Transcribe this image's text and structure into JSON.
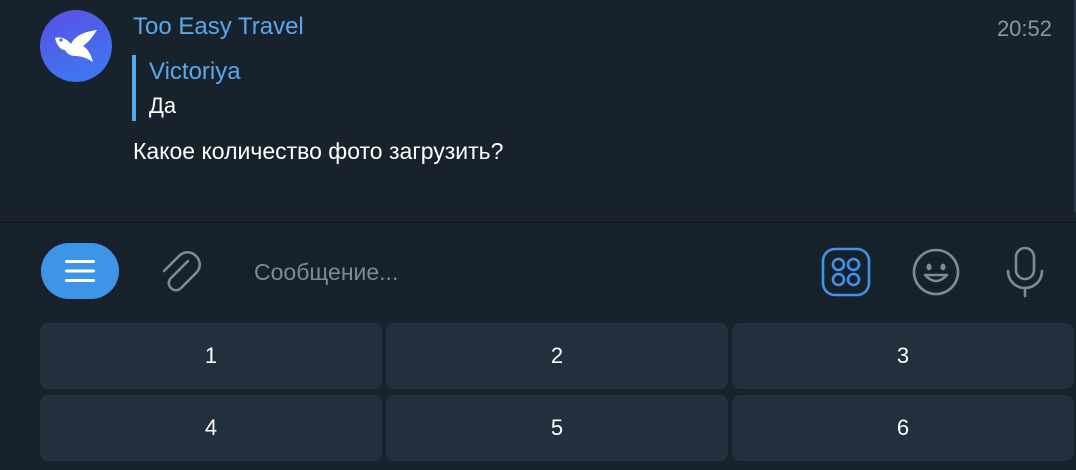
{
  "message": {
    "sender": "Too Easy Travel",
    "time": "20:52",
    "reply": {
      "author": "Victoriya",
      "text": "Да"
    },
    "text": "Какое количество фото загрузить?"
  },
  "composer": {
    "placeholder": "Сообщение..."
  },
  "keyboard": {
    "rows": [
      [
        "1",
        "2",
        "3"
      ],
      [
        "4",
        "5",
        "6"
      ]
    ]
  },
  "colors": {
    "accent": "#3e95e8",
    "link": "#5aa8ec",
    "background": "#18222d",
    "key": "#222f3d"
  },
  "icons": {
    "avatar": "bird-icon",
    "menu": "menu-icon",
    "attach": "paperclip-icon",
    "commands": "bot-commands-icon",
    "emoji": "smile-icon",
    "voice": "microphone-icon"
  }
}
